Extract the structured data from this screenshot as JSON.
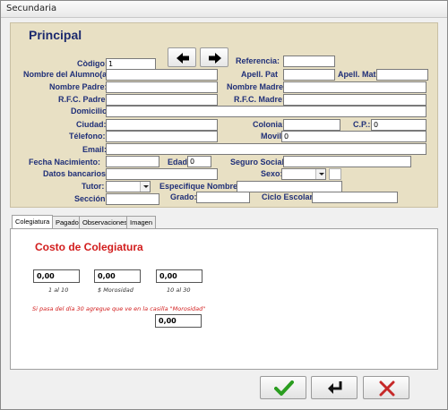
{
  "window": {
    "title": "Secundaria"
  },
  "section": {
    "title": "Principal"
  },
  "labels": {
    "codigo": "Còdigo:",
    "referencia": "Referencia:",
    "nombre_alumno": "Nombre del Alumno(a)",
    "apell_pat": "Apell. Pat",
    "apell_mat": "Apell. Mat",
    "nombre_padre": "Nombre Padre:",
    "nombre_madre": "Nombre Madre",
    "rfc_padre": "R.F.C. Padre:",
    "rfc_madre": "R.F.C. Madre:",
    "domicilio": "Domicilio:",
    "ciudad": "Ciudad:",
    "colonia": "Colonia:",
    "cp": "C.P.:",
    "telefono": "Télefono:",
    "movil": "Movil",
    "email": "Email:",
    "fecha_nacimiento": "Fecha Nacimiento:",
    "edad": "Edad:",
    "seguro_social": "Seguro Social:",
    "datos_bancarios": "Datos bancarios:",
    "sexo": "Sexo:",
    "tutor": "Tutor:",
    "especifique_nombre": "Especifique Nombre:",
    "seccion": "Sección:",
    "grado": "Grado:",
    "ciclo_escolar": "Ciclo Escolar:"
  },
  "values": {
    "codigo": "1",
    "cp": "0",
    "movil": "0",
    "edad": "0"
  },
  "tabs": [
    "Colegiatura",
    "Pagado",
    "Observaciones",
    "Imagen"
  ],
  "colegiatura": {
    "title": "Costo de Colegiatura",
    "fields": [
      {
        "value": "0,00",
        "caption": "1 al 10"
      },
      {
        "value": "0,00",
        "caption": "$ Morosidad"
      },
      {
        "value": "0,00",
        "caption": "10 al 30"
      }
    ],
    "note": "Si pasa del día 30 agregue que ve en la casilla \"Morosidad\"",
    "extra_value": "0,00"
  },
  "icons": {
    "prev": "arrow-left-icon",
    "next": "arrow-right-icon",
    "accept": "checkmark-icon",
    "back": "return-icon",
    "cancel": "close-icon"
  },
  "colors": {
    "label": "#1f2f78",
    "heading": "#1c2a6e",
    "accent_red": "#d21d1d",
    "panel": "#e8e0c4",
    "check": "#2a9d1f"
  }
}
